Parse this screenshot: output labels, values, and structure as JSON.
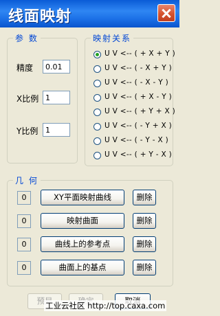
{
  "title": "线面映射",
  "params": {
    "legend": "参 数",
    "precision": {
      "label": "精度",
      "value": "0.01"
    },
    "x_ratio": {
      "label": "X比例",
      "value": "1"
    },
    "y_ratio": {
      "label": "Y比例",
      "value": "1"
    }
  },
  "mapping": {
    "legend": "映射关系",
    "options": [
      {
        "label": "U V <-- ( + X + Y )",
        "checked": true
      },
      {
        "label": "U V <-- ( - X + Y )",
        "checked": false
      },
      {
        "label": "U V <-- ( - X - Y )",
        "checked": false
      },
      {
        "label": "U V <-- ( + X - Y )",
        "checked": false
      },
      {
        "label": "U V <-- ( + Y + X )",
        "checked": false
      },
      {
        "label": "U V <-- ( - Y + X )",
        "checked": false
      },
      {
        "label": "U V <-- ( - Y - X )",
        "checked": false
      },
      {
        "label": "U V <-- ( + Y - X )",
        "checked": false
      }
    ]
  },
  "geometry": {
    "legend": "几 何",
    "rows": [
      {
        "count": "0",
        "label": "XY平面映射曲线",
        "delete": "删除"
      },
      {
        "count": "0",
        "label": "映射曲面",
        "delete": "删除"
      },
      {
        "count": "0",
        "label": "曲线上的参考点",
        "delete": "删除"
      },
      {
        "count": "0",
        "label": "曲面上的基点",
        "delete": "删除"
      }
    ]
  },
  "footer": {
    "preview": "预显",
    "ok": "确定",
    "cancel": "取消",
    "watermark": "工业云社区 http://top.caxa.com"
  }
}
